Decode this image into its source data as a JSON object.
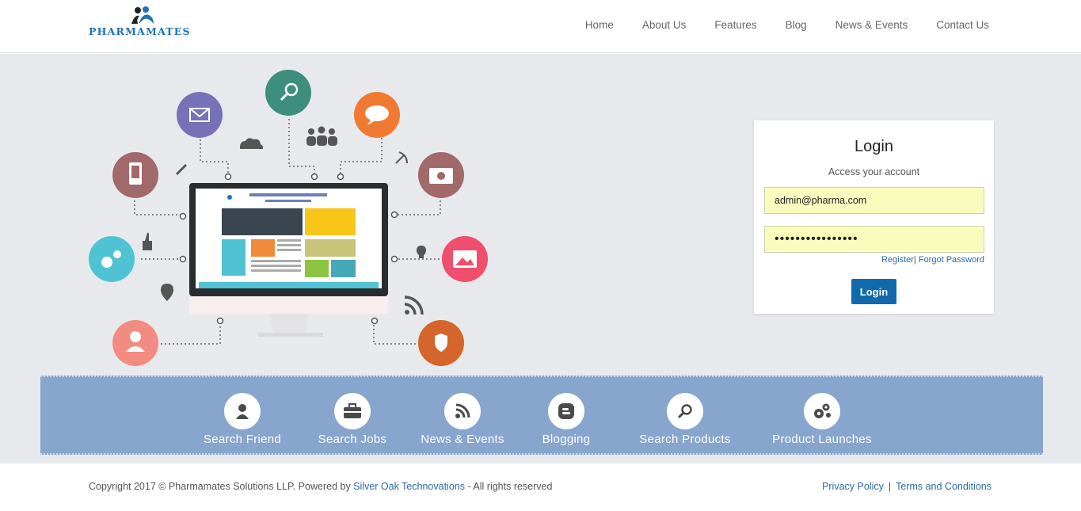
{
  "brand": {
    "name": "PHARMAMATES"
  },
  "nav": {
    "items": [
      {
        "label": "Home"
      },
      {
        "label": "About Us"
      },
      {
        "label": "Features"
      },
      {
        "label": "Blog"
      },
      {
        "label": "News & Events"
      },
      {
        "label": "Contact Us"
      }
    ]
  },
  "login": {
    "title": "Login",
    "subtitle": "Access your account",
    "email_value": "admin@pharma.com",
    "password_value": "••••••••••••••••",
    "register_label": "Register",
    "forgot_label": "Forgot Password",
    "button_label": "Login"
  },
  "features": [
    {
      "label": "Search Friend",
      "icon": "person-icon"
    },
    {
      "label": "Search Jobs",
      "icon": "briefcase-icon"
    },
    {
      "label": "News & Events",
      "icon": "rss-icon"
    },
    {
      "label": "Blogging",
      "icon": "blogger-icon"
    },
    {
      "label": "Search Products",
      "icon": "search-icon"
    },
    {
      "label": "Product Launches",
      "icon": "gears-icon"
    }
  ],
  "footer": {
    "copyright_prefix": "Copyright 2017 © Pharmamates Solutions LLP. Powered by ",
    "powered_by": "Silver Oak Technovations",
    "copyright_suffix": " - All rights reserved",
    "privacy": "Privacy Policy",
    "terms": "Terms and Conditions"
  },
  "colors": {
    "brand_blue": "#1f72b8",
    "button_blue": "#126aad",
    "hero_bg": "#e8e9ed",
    "strip_bg": "#87a5cd",
    "input_bg": "#fafcbe"
  }
}
